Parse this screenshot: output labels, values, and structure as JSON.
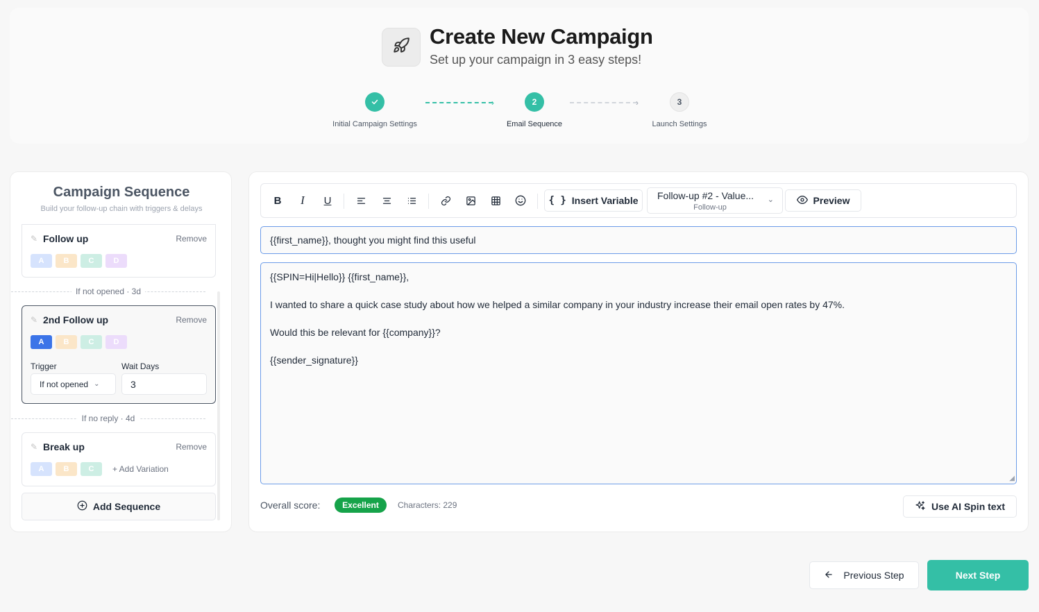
{
  "header": {
    "title": "Create New Campaign",
    "subtitle": "Set up your campaign in 3 easy steps!",
    "logo_icon": "rocket-icon"
  },
  "steps": [
    {
      "number": "1",
      "label": "Initial Campaign Settings",
      "state": "complete"
    },
    {
      "number": "2",
      "label": "Email Sequence",
      "state": "active"
    },
    {
      "number": "3",
      "label": "Launch Settings",
      "state": "pending"
    }
  ],
  "colors": {
    "accent": "#34bfa6",
    "variant_active": "#3b74e8",
    "score_badge": "#16a34a"
  },
  "sequence_panel": {
    "title": "Campaign Sequence",
    "subtitle": "Build your follow-up chain with triggers & delays",
    "remove_label": "Remove",
    "add_sequence_label": "Add Sequence",
    "items": [
      {
        "name": "Follow up",
        "variants": [
          "A",
          "B",
          "C",
          "D"
        ]
      },
      {
        "divider": "If not opened · 3d"
      },
      {
        "name": "2nd Follow up",
        "variants": [
          "A",
          "B",
          "C",
          "D"
        ],
        "active_variant": "A",
        "trigger_label": "Trigger",
        "trigger_value": "If not opened",
        "wait_label": "Wait Days",
        "wait_value": "3"
      },
      {
        "divider": "If no reply · 4d"
      },
      {
        "name": "Break up",
        "variants": [
          "A",
          "B",
          "C"
        ],
        "add_variation_label": "+ Add Variation"
      }
    ]
  },
  "toolbar": {
    "icons": [
      "bold-icon",
      "italic-icon",
      "underline-icon",
      "align-left-icon",
      "align-center-icon",
      "list-icon",
      "link-icon",
      "image-icon",
      "table-icon",
      "emoji-icon"
    ],
    "insert_variable_label": "Insert Variable",
    "template_select": {
      "value": "Follow-up #2 - Value...",
      "sub": "Follow-up"
    },
    "preview_label": "Preview"
  },
  "editor": {
    "subject": "{{first_name}}, thought you might find this useful",
    "body_lines": [
      "{{SPIN=Hi|Hello}} {{first_name}},",
      "I wanted to share a quick case study about how we helped a similar company in your industry increase their email open rates by 47%.",
      "Would this be relevant for {{company}}?",
      "{{sender_signature}}"
    ]
  },
  "footer": {
    "score_label": "Overall score:",
    "score_value": "Excellent",
    "characters_label": "Characters: 229",
    "ai_spin_label": "Use AI Spin text"
  },
  "navigation": {
    "previous_label": "Previous Step",
    "next_label": "Next Step"
  }
}
